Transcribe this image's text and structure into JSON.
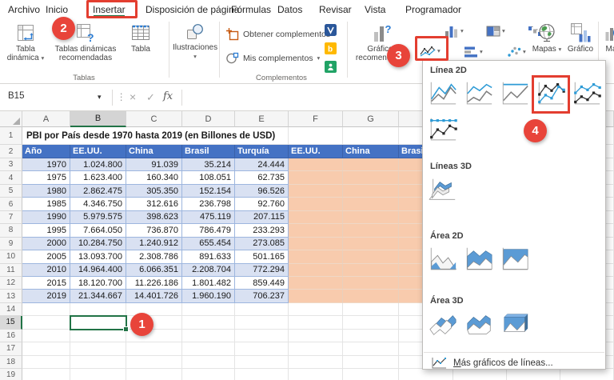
{
  "menu_tabs": [
    {
      "label": "Archivo"
    },
    {
      "label": "Inicio"
    },
    {
      "label": "Insertar",
      "active": true
    },
    {
      "label": "Disposición de página"
    },
    {
      "label": "Fórmulas"
    },
    {
      "label": "Datos"
    },
    {
      "label": "Revisar"
    },
    {
      "label": "Vista"
    },
    {
      "label": "Programador"
    }
  ],
  "ribbon": {
    "tablas": {
      "group_label": "Tablas",
      "pivot_table": "Tabla dinámica",
      "recommended_pivots": "Tablas dinámicas recomendadas",
      "table": "Tabla"
    },
    "ilustraciones": {
      "label": "Ilustraciones"
    },
    "complementos": {
      "group_label": "Complementos",
      "get_addins": "Obtener complementos",
      "my_addins": "Mis complementos"
    },
    "graficos": {
      "recommended_charts": "Gráficos recomendados",
      "maps": "Mapas",
      "pivot_chart": "Gráfico",
      "map_3d": "Mapa"
    }
  },
  "formula_bar": {
    "name_box": "B15",
    "fx_label": "fx"
  },
  "sheet": {
    "col_letters": [
      "A",
      "B",
      "C",
      "D",
      "E",
      "F",
      "G"
    ],
    "selected_cell": "B15",
    "selected_column": "B",
    "selected_row": 15,
    "row_count": 19,
    "title": "PBI por País desde 1970 hasta 2019 (en Billones de USD)",
    "headers": [
      "Año",
      "EE.UU.",
      "China",
      "Brasil",
      "Turquía"
    ],
    "secondary_headers": [
      "EE.UU.",
      "China",
      "Brasil"
    ],
    "rows": [
      {
        "year": "1970",
        "values": [
          "1.024.800",
          "91.039",
          "35.214",
          "24.444"
        ]
      },
      {
        "year": "1975",
        "values": [
          "1.623.400",
          "160.340",
          "108.051",
          "62.735"
        ]
      },
      {
        "year": "1980",
        "values": [
          "2.862.475",
          "305.350",
          "152.154",
          "96.526"
        ]
      },
      {
        "year": "1985",
        "values": [
          "4.346.750",
          "312.616",
          "236.798",
          "92.760"
        ]
      },
      {
        "year": "1990",
        "values": [
          "5.979.575",
          "398.623",
          "475.119",
          "207.115"
        ]
      },
      {
        "year": "1995",
        "values": [
          "7.664.050",
          "736.870",
          "786.479",
          "233.293"
        ]
      },
      {
        "year": "2000",
        "values": [
          "10.284.750",
          "1.240.912",
          "655.454",
          "273.085"
        ]
      },
      {
        "year": "2005",
        "values": [
          "13.093.700",
          "2.308.786",
          "891.633",
          "501.165"
        ]
      },
      {
        "year": "2010",
        "values": [
          "14.964.400",
          "6.066.351",
          "2.208.704",
          "772.294"
        ]
      },
      {
        "year": "2015",
        "values": [
          "18.120.700",
          "11.226.186",
          "1.801.482",
          "859.449"
        ]
      },
      {
        "year": "2019",
        "values": [
          "21.344.667",
          "14.401.726",
          "1.960.190",
          "706.237"
        ]
      }
    ]
  },
  "chart_menu": {
    "sections": [
      {
        "title": "Línea 2D",
        "items": [
          "line",
          "stacked-line",
          "stacked-line-100",
          "line-markers",
          "stacked-line-markers",
          "stacked-line-100-markers"
        ],
        "highlighted": "line-markers"
      },
      {
        "title": "Líneas 3D",
        "items": [
          "line-3d"
        ]
      },
      {
        "title": "Área 2D",
        "items": [
          "area",
          "stacked-area",
          "stacked-area-100"
        ]
      },
      {
        "title": "Área 3D",
        "items": [
          "area-3d",
          "stacked-area-3d",
          "stacked-area-100-3d"
        ]
      }
    ],
    "footer": {
      "accel": "M",
      "rest": "ás gráficos de líneas..."
    }
  },
  "annotations": {
    "accent_color": "#E33E30",
    "badges": [
      "1",
      "2",
      "3",
      "4"
    ]
  }
}
